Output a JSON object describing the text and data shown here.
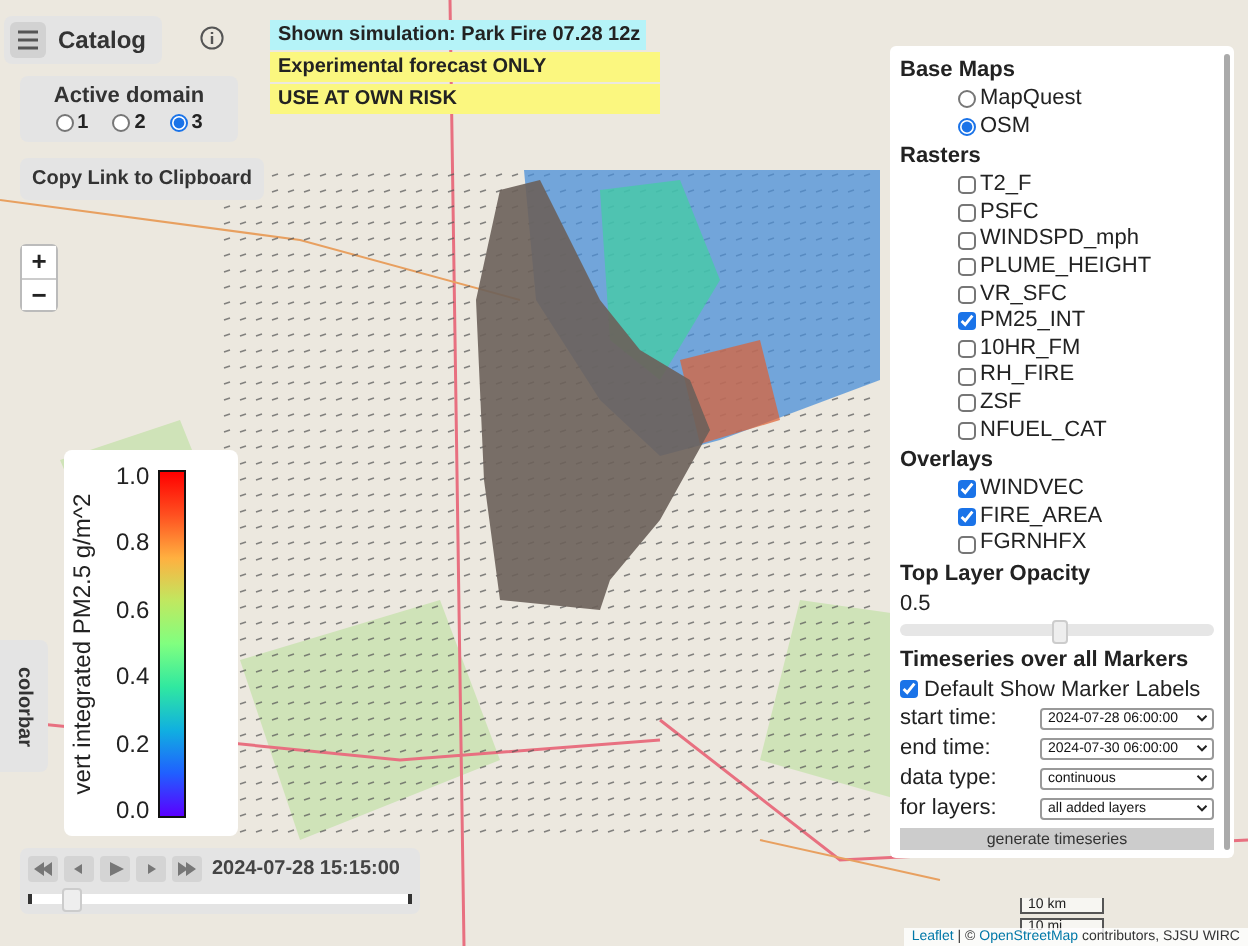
{
  "catalog": {
    "label": "Catalog"
  },
  "banners": [
    {
      "text": "Shown simulation: Park Fire 07.28 12z",
      "kind": "info"
    },
    {
      "text": "Experimental forecast ONLY",
      "kind": "warning"
    },
    {
      "text": "USE AT OWN RISK",
      "kind": "warning"
    }
  ],
  "active_domain": {
    "title": "Active domain",
    "options": [
      {
        "label": "1",
        "selected": false
      },
      {
        "label": "2",
        "selected": false
      },
      {
        "label": "3",
        "selected": true
      }
    ]
  },
  "copy_link_button": "Copy Link to Clipboard",
  "zoom": {
    "zoom_in": "+",
    "zoom_out": "−"
  },
  "colorbar": {
    "label": "vert integrated PM2.5 g/m^2",
    "ticks": [
      "1.0",
      "0.8",
      "0.6",
      "0.4",
      "0.2",
      "0.0"
    ],
    "tab": "colorbar"
  },
  "playback": {
    "time": "2024-07-28 15:15:00",
    "level": 0.1
  },
  "layers_panel": {
    "sections": [
      {
        "title": "Base Maps",
        "items": [
          {
            "label": "MapQuest",
            "kind": "radio",
            "checked": false
          },
          {
            "label": "OSM",
            "kind": "radio",
            "checked": true
          }
        ]
      },
      {
        "title": "Rasters",
        "items": [
          {
            "label": "T2_F",
            "kind": "checkbox",
            "checked": false
          },
          {
            "label": "PSFC",
            "kind": "checkbox",
            "checked": false
          },
          {
            "label": "WINDSPD_mph",
            "kind": "checkbox",
            "checked": false
          },
          {
            "label": "PLUME_HEIGHT",
            "kind": "checkbox",
            "checked": false
          },
          {
            "label": "VR_SFC",
            "kind": "checkbox",
            "checked": false
          },
          {
            "label": "PM25_INT",
            "kind": "checkbox",
            "checked": true
          },
          {
            "label": "10HR_FM",
            "kind": "checkbox",
            "checked": false
          },
          {
            "label": "RH_FIRE",
            "kind": "checkbox",
            "checked": false
          },
          {
            "label": "ZSF",
            "kind": "checkbox",
            "checked": false
          },
          {
            "label": "NFUEL_CAT",
            "kind": "checkbox",
            "checked": false
          }
        ]
      },
      {
        "title": "Overlays",
        "items": [
          {
            "label": "WINDVEC",
            "kind": "checkbox",
            "checked": true
          },
          {
            "label": "FIRE_AREA",
            "kind": "checkbox",
            "checked": true
          },
          {
            "label": "FGRNHFX",
            "kind": "checkbox",
            "checked": false
          }
        ]
      }
    ],
    "opacity": {
      "title": "Top Layer Opacity",
      "value": "0.5",
      "level": 0.5
    },
    "timeseries": {
      "title": "Timeseries over all Markers",
      "show_labels": {
        "label": "Default Show Marker Labels",
        "checked": true
      },
      "fields": [
        {
          "label": "start time:",
          "value": "2024-07-28 06:00:00"
        },
        {
          "label": "end time:",
          "value": "2024-07-30 06:00:00"
        },
        {
          "label": "data type:",
          "value": "continuous"
        },
        {
          "label": "for layers:",
          "value": "all added layers"
        }
      ],
      "button": "generate timeseries"
    }
  },
  "scale": [
    "10 km",
    "10 mi"
  ],
  "attribution": {
    "leaflet": "Leaflet",
    "middle": " | © ",
    "osm": "OpenStreetMap",
    "rest": " contributors, SJSU WIRC"
  }
}
